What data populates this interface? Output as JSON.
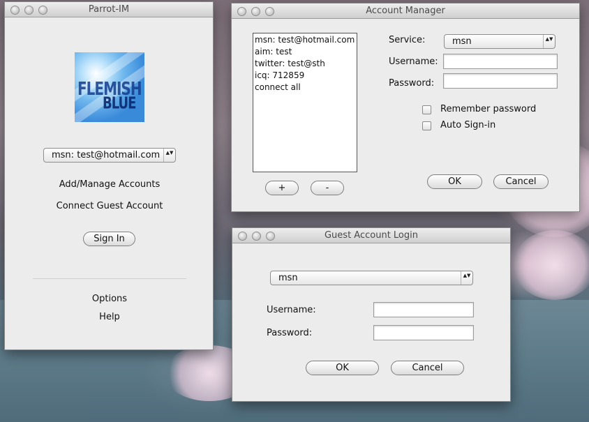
{
  "parrot": {
    "title": "Parrot-IM",
    "logo_line1": "FLEMISH",
    "logo_line2": "BLUE",
    "account_select": "msn: test@hotmail.com",
    "add_manage": "Add/Manage Accounts",
    "connect_guest": "Connect Guest Account",
    "sign_in": "Sign In",
    "options": "Options",
    "help": "Help"
  },
  "account_manager": {
    "title": "Account Manager",
    "accounts": [
      "msn: test@hotmail.com",
      "aim: test",
      "twitter: test@sth",
      "icq: 712859",
      "connect all"
    ],
    "add_button": "+",
    "remove_button": "-",
    "service_label": "Service:",
    "service_value": "msn",
    "username_label": "Username:",
    "username_value": "",
    "password_label": "Password:",
    "password_value": "",
    "remember_label": "Remember password",
    "autosignin_label": "Auto Sign-in",
    "ok": "OK",
    "cancel": "Cancel"
  },
  "guest_login": {
    "title": "Guest Account Login",
    "service_value": "msn",
    "username_label": "Username:",
    "username_value": "",
    "password_label": "Password:",
    "password_value": "",
    "ok": "OK",
    "cancel": "Cancel"
  },
  "popup_arrows": "▲▼"
}
